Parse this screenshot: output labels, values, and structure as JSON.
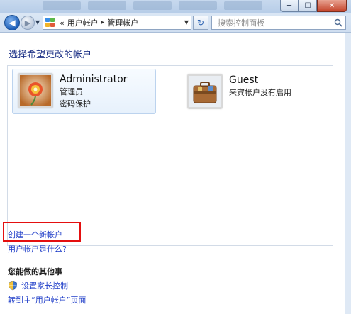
{
  "window": {
    "minimize_glyph": "─",
    "maximize_glyph": "☐",
    "close_glyph": "✕"
  },
  "toolbar": {
    "back_glyph": "◀",
    "forward_glyph": "▶",
    "dropdown_glyph": "▼",
    "breadcrumb_lead": "«",
    "breadcrumbs": [
      "用户帐户",
      "管理帐户"
    ],
    "breadcrumb_separator": "▸",
    "refresh_glyph": "↻",
    "search_placeholder": "搜索控制面板"
  },
  "main": {
    "title": "选择希望更改的帐户",
    "accounts": [
      {
        "name": "Administrator",
        "lines": [
          "管理员",
          "密码保护"
        ],
        "icon": "flower-avatar-icon",
        "selected": true
      },
      {
        "name": "Guest",
        "lines": [
          "来宾帐户没有启用"
        ],
        "icon": "suitcase-avatar-icon",
        "selected": false
      }
    ],
    "create_account_link": "创建一个新帐户",
    "what_is_link": "用户帐户是什么?",
    "other_tasks_heading": "您能做的其他事",
    "parental_controls_link": "设置家长控制",
    "goto_main_link": "转到主“用户帐户”页面"
  },
  "colors": {
    "link": "#1e3dc8",
    "title": "#1e3287",
    "highlight": "#e40f0f"
  }
}
